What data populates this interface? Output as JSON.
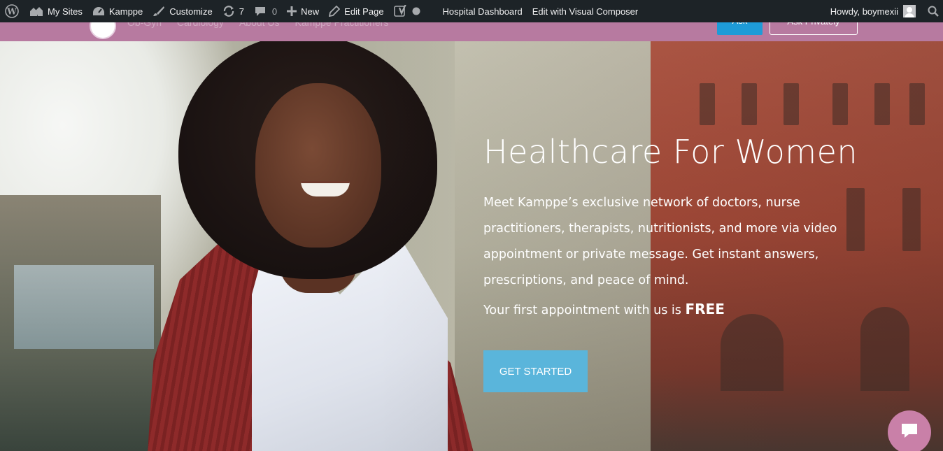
{
  "adminbar": {
    "wp_logo_icon": "wordpress-icon",
    "my_sites": "My Sites",
    "site_name": "Kamppe",
    "customize": "Customize",
    "updates_count": "7",
    "comments_count": "0",
    "new": "New",
    "edit_page": "Edit Page",
    "hospital_dashboard": "Hospital Dashboard",
    "edit_visual_composer": "Edit with Visual Composer",
    "howdy": "Howdy, boymexii"
  },
  "header": {
    "nav_items": [
      "Ob-Gyn",
      "Cardiology",
      "About Us",
      "Kamppe Practitioners"
    ],
    "ask_button": "Ask",
    "ask_privately_button": "Ask Privately"
  },
  "hero": {
    "title": "Healthcare For Women",
    "description": "Meet Kamppe’s exclusive network of doctors, nurse practitioners, therapists, nutritionists, and more via video appointment or private message. Get instant answers, prescriptions, and peace of mind.",
    "free_prefix": "Your first appointment with us is ",
    "free_word": "FREE",
    "cta": "GET STARTED"
  },
  "colors": {
    "adminbar_bg": "#1d2327",
    "header_bg": "#b77aa0",
    "ask_blue": "#1e9bd7",
    "cta_blue": "#5ab5db",
    "chat_pink": "#c980a8"
  }
}
